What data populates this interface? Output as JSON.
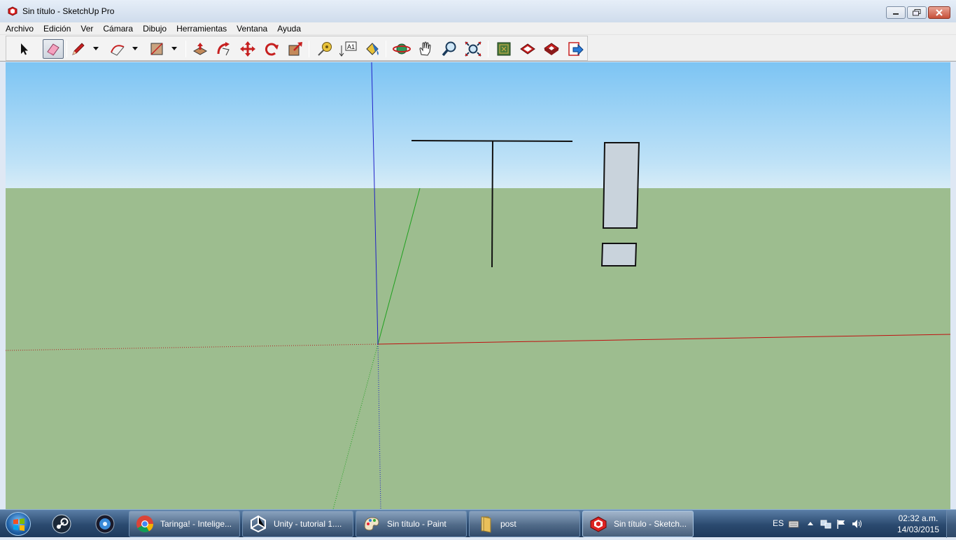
{
  "window": {
    "title": "Sin título - SketchUp Pro",
    "minimize_icon": "minimize-icon",
    "maximize_icon": "restore-icon",
    "close_icon": "close-icon"
  },
  "menu": [
    "Archivo",
    "Edición",
    "Ver",
    "Cámara",
    "Dibujo",
    "Herramientas",
    "Ventana",
    "Ayuda"
  ],
  "toolbar": {
    "tools": [
      "select",
      "eraser",
      "line",
      "arc",
      "rectangle",
      "push-pull",
      "follow-me",
      "move",
      "rotate",
      "scale",
      "tape-measure",
      "text",
      "paint-bucket",
      "orbit",
      "pan",
      "zoom",
      "zoom-extents",
      "get-models",
      "share-model",
      "share-component",
      "send-to-layout"
    ],
    "active_tool": "eraser"
  },
  "viewport": {
    "sky_color": "#8ccbf4",
    "ground_color": "#9dbd8f",
    "axis_colors": {
      "red": "#c01010",
      "green": "#1fa01f",
      "blue": "#2020c8"
    },
    "face_color": "#c9d3dc"
  },
  "taskbar": {
    "pinned": [
      "steam-icon",
      "media-center-icon"
    ],
    "buttons": [
      {
        "label": "Taringa! - Intelige...",
        "icon": "chrome-icon"
      },
      {
        "label": "Unity - tutorial 1....",
        "icon": "unity-icon"
      },
      {
        "label": "Sin título - Paint",
        "icon": "paint-icon"
      },
      {
        "label": "post",
        "icon": "folder-icon"
      },
      {
        "label": "Sin título - Sketch...",
        "icon": "sketchup-icon"
      }
    ],
    "active_button": "Sin título - Sketch...",
    "language": "ES",
    "time": "02:32 a.m.",
    "date": "14/03/2015"
  }
}
